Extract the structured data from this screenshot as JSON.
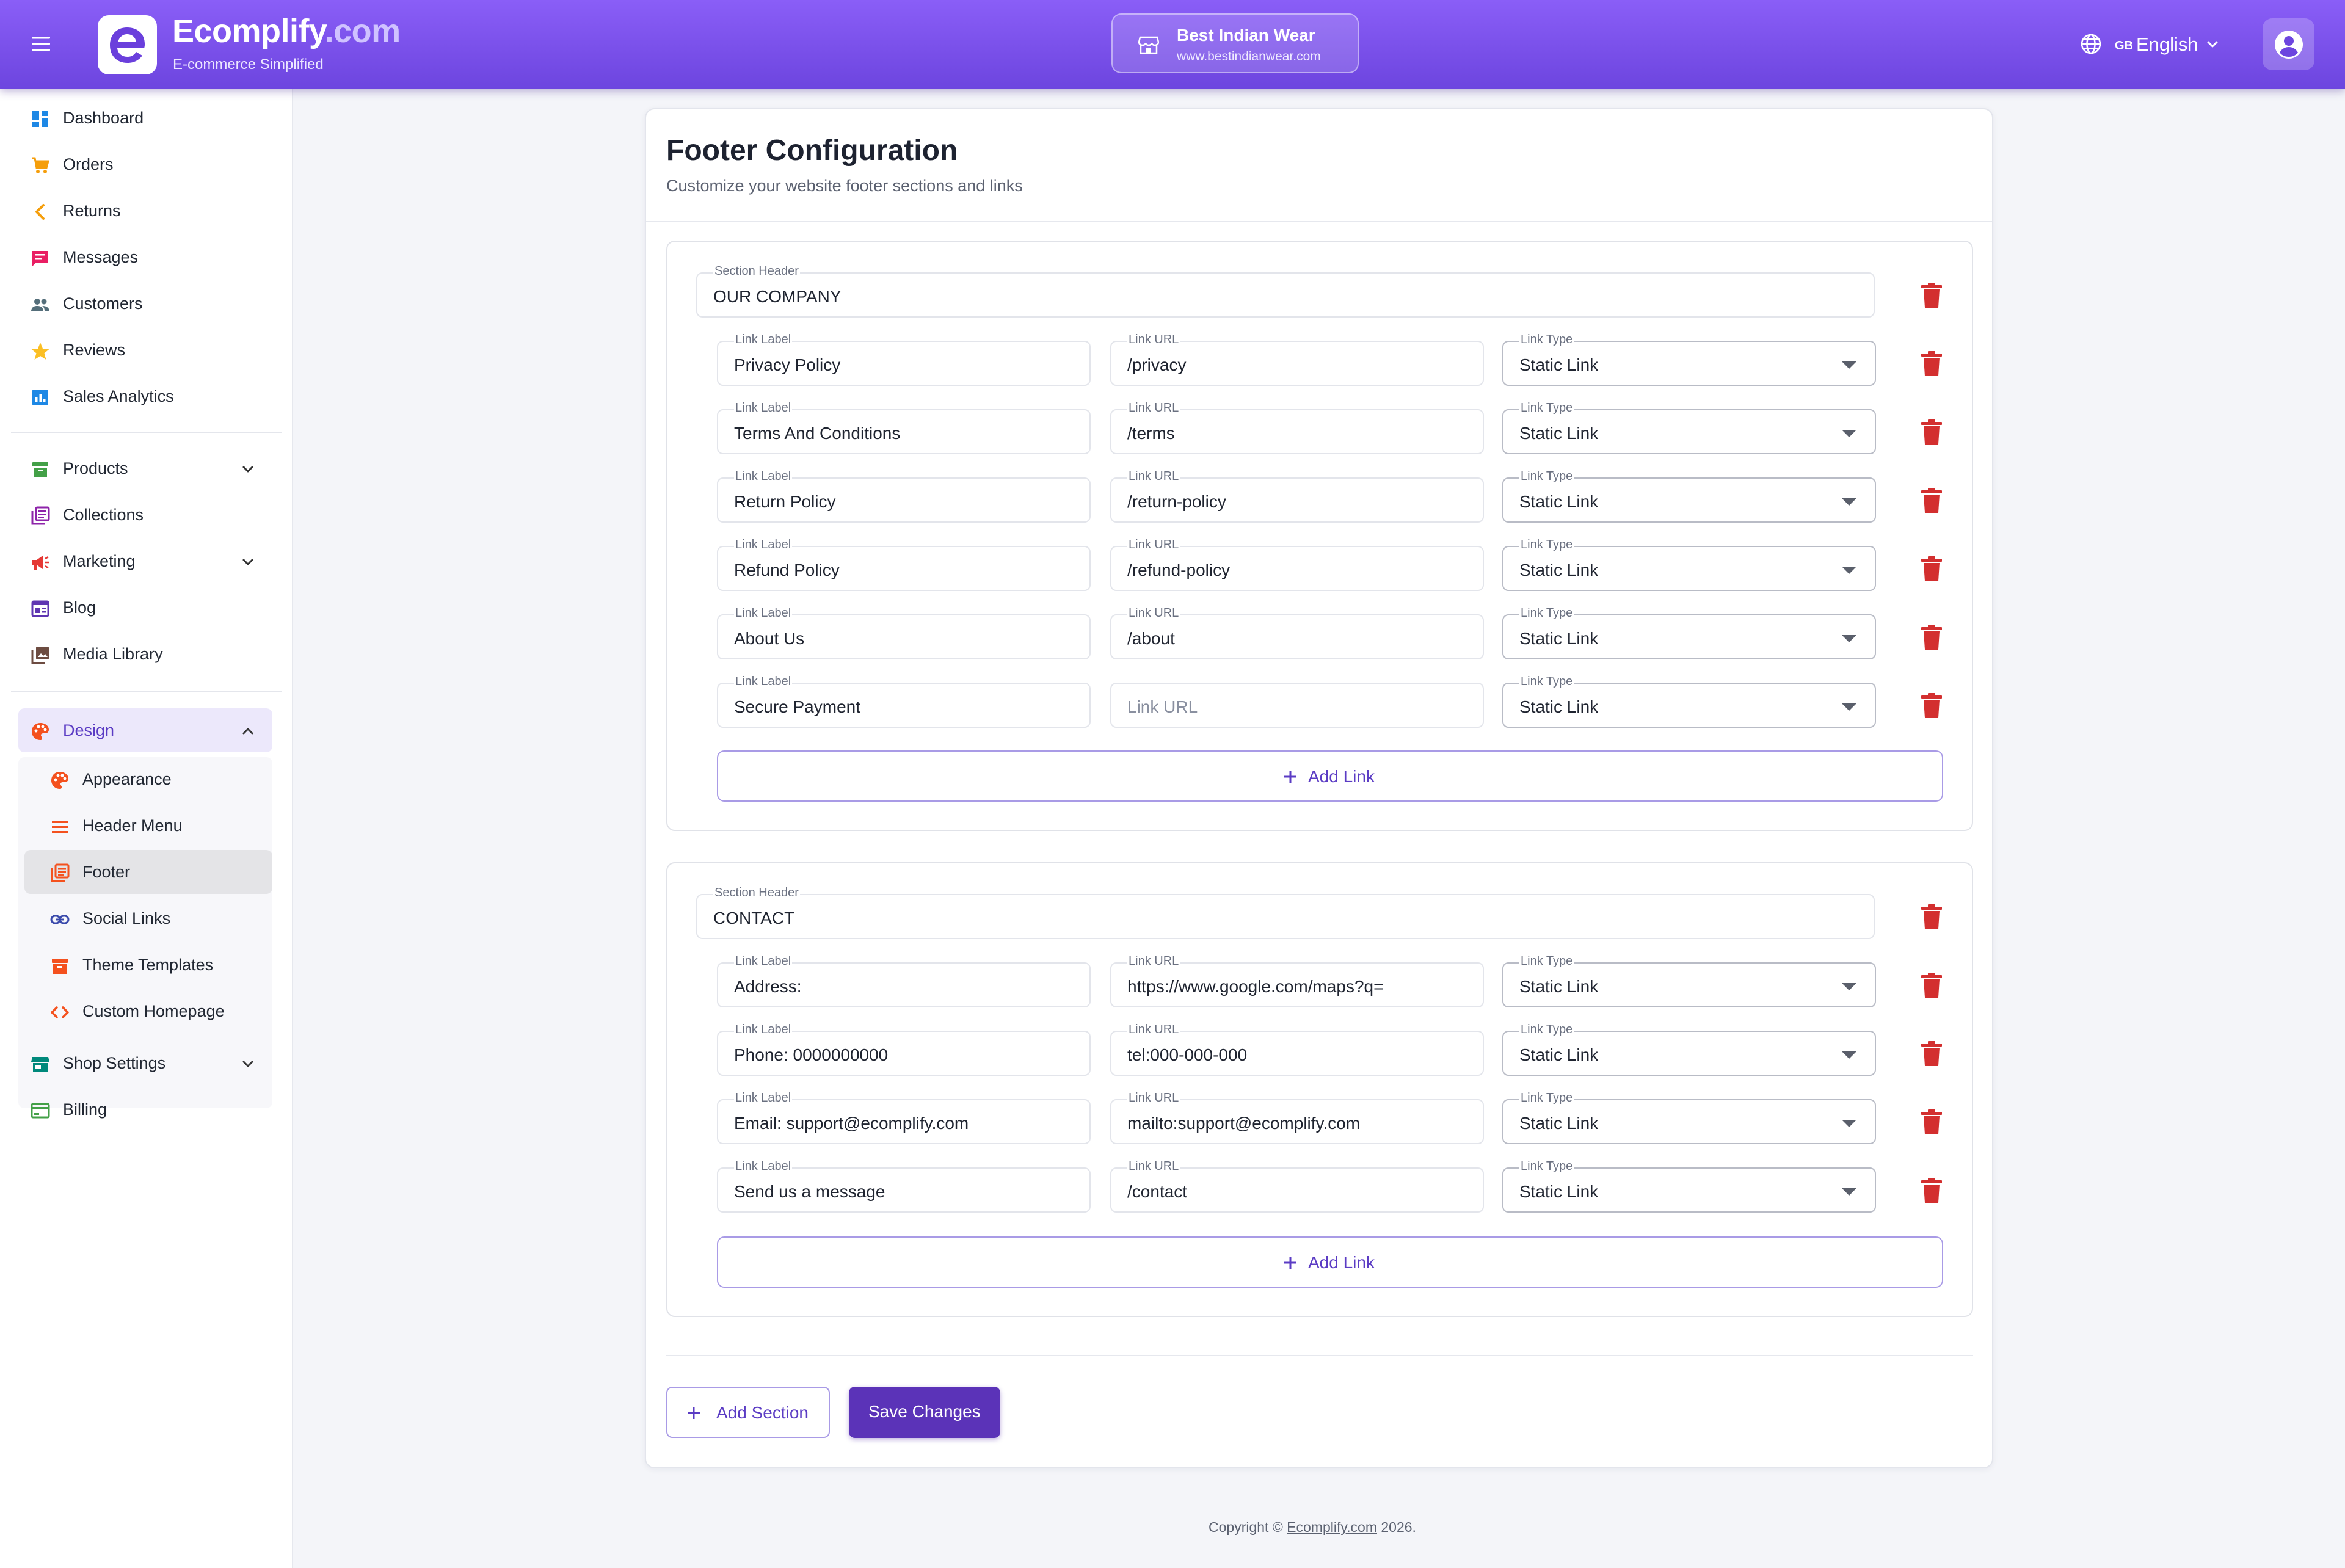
{
  "header": {
    "brand_name": "Ecomplify",
    "brand_tld": ".com",
    "brand_tagline": "E-commerce Simplified",
    "store_name": "Best Indian Wear",
    "store_url": "www.bestindianwear.com",
    "language_flag": "GB",
    "language": "English",
    "icons": [
      "menu-icon",
      "store-icon",
      "globe-icon",
      "chevron-down-icon",
      "account-icon"
    ]
  },
  "sidebar": {
    "items": [
      {
        "label": "Dashboard",
        "icon": "dashboard-icon",
        "color": "#1e88e5"
      },
      {
        "label": "Orders",
        "icon": "cart-icon",
        "color": "#f59e0b"
      },
      {
        "label": "Returns",
        "icon": "chevron-left-icon",
        "color": "#f59e0b"
      },
      {
        "label": "Messages",
        "icon": "chat-icon",
        "color": "#e91e63"
      },
      {
        "label": "Customers",
        "icon": "people-icon",
        "color": "#546e7a"
      },
      {
        "label": "Reviews",
        "icon": "star-icon",
        "color": "#fbbf24"
      },
      {
        "label": "Sales Analytics",
        "icon": "analytics-icon",
        "color": "#1e88e5"
      },
      {
        "label": "Products",
        "icon": "box-icon",
        "color": "#43a047"
      },
      {
        "label": "Collections",
        "icon": "collections-icon",
        "color": "#8e24aa"
      },
      {
        "label": "Marketing",
        "icon": "megaphone-icon",
        "color": "#e53935"
      },
      {
        "label": "Blog",
        "icon": "blog-icon",
        "color": "#5e35b1"
      },
      {
        "label": "Media Library",
        "icon": "media-icon",
        "color": "#6d4c41"
      },
      {
        "label": "Design",
        "icon": "palette-icon",
        "color": "#f4511e"
      },
      {
        "label": "Shop Settings",
        "icon": "shop-icon",
        "color": "#00897b"
      },
      {
        "label": "Billing",
        "icon": "card-icon",
        "color": "#43a047"
      }
    ],
    "design_sub": [
      {
        "label": "Appearance",
        "icon": "palette-icon"
      },
      {
        "label": "Header Menu",
        "icon": "menu-lines-icon"
      },
      {
        "label": "Footer",
        "icon": "footer-icon"
      },
      {
        "label": "Social Links",
        "icon": "link-icon"
      },
      {
        "label": "Theme Templates",
        "icon": "template-icon"
      },
      {
        "label": "Custom Homepage",
        "icon": "code-icon"
      }
    ],
    "active_item": "Footer",
    "accent": "#5b3cc4"
  },
  "page": {
    "title": "Footer Configuration",
    "subtitle": "Customize your website footer sections and links",
    "field_labels": {
      "section_header": "Section Header",
      "link_label": "Link Label",
      "link_url": "Link URL",
      "link_type": "Link Type"
    },
    "add_link_label": "Add Link",
    "add_section_label": "Add Section",
    "save_label": "Save Changes",
    "sections": [
      {
        "header": "OUR COMPANY",
        "links": [
          {
            "label": "Privacy Policy",
            "url": "/privacy",
            "type": "Static Link"
          },
          {
            "label": "Terms And Conditions",
            "url": "/terms",
            "type": "Static Link"
          },
          {
            "label": "Return Policy",
            "url": "/return-policy",
            "type": "Static Link"
          },
          {
            "label": "Refund Policy",
            "url": "/refund-policy",
            "type": "Static Link"
          },
          {
            "label": "About Us",
            "url": "/about",
            "type": "Static Link"
          },
          {
            "label": "Secure Payment",
            "url": "",
            "url_placeholder": "Link URL",
            "type": "Static Link"
          }
        ]
      },
      {
        "header": "CONTACT",
        "links": [
          {
            "label": "Address:",
            "url": "https://www.google.com/maps?q=",
            "type": "Static Link"
          },
          {
            "label": "Phone: 0000000000",
            "url": "tel:000-000-000",
            "type": "Static Link"
          },
          {
            "label": "Email: support@ecomplify.com",
            "url": "mailto:support@ecomplify.com",
            "type": "Static Link"
          },
          {
            "label": "Send us a message",
            "url": "/contact",
            "type": "Static Link"
          }
        ]
      }
    ]
  },
  "footer": {
    "copyright_prefix": "Copyright ©",
    "copyright_link": "Ecomplify.com",
    "copyright_year": "2026."
  },
  "colors": {
    "topbar": "#7b52ef",
    "primary_button": "#5b33b8",
    "delete": "#d32f2f"
  }
}
